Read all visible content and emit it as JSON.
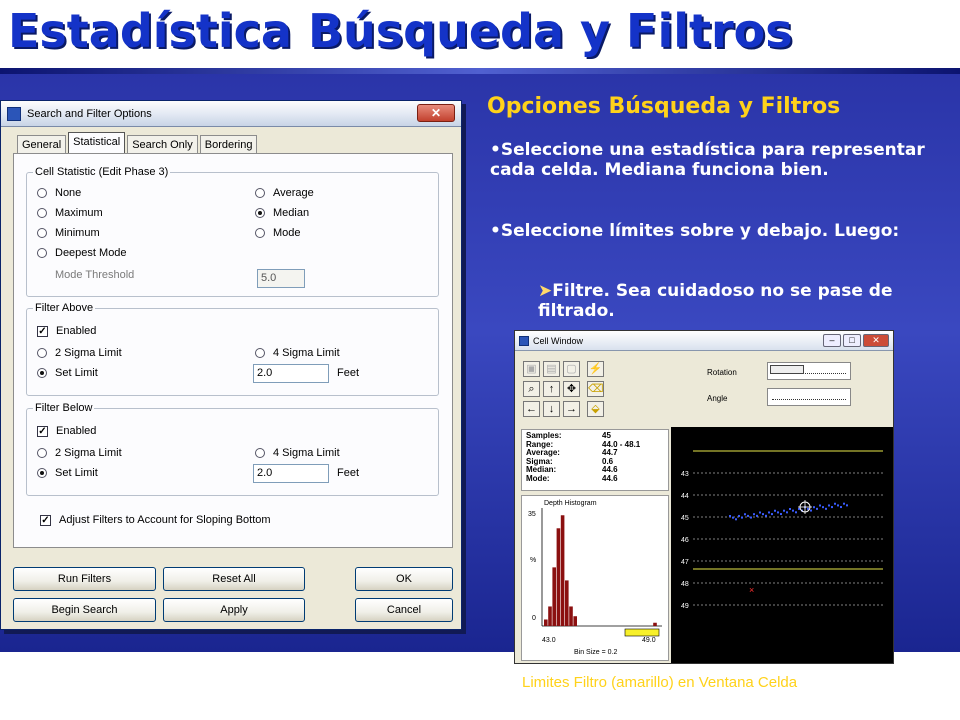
{
  "slide": {
    "title": "Estadística Búsqueda y Filtros",
    "heading": "Opciones Búsqueda y Filtros",
    "bullet1": "•Seleccione una estadística para representar cada celda.  Mediana funciona bien.",
    "bullet2": "•Seleccione límites sobre y debajo. Luego:",
    "bullet3": "Filtre.  Sea cuidadoso no se pase de filtrado.",
    "bullet3_marker": "➤",
    "caption": "Limites Filtro (amarillo) en Ventana Celda",
    "colors": {
      "title": "#1433c8",
      "heading": "#ffd21a",
      "background": "#2a34a8"
    }
  },
  "dialog": {
    "title": "Search and Filter Options",
    "close_label": "✕",
    "tabs": [
      "General",
      "Statistical",
      "Search Only",
      "Bordering"
    ],
    "active_tab": "Statistical",
    "cell_statistic": {
      "label": "Cell Statistic (Edit Phase 3)",
      "none": "None",
      "maximum": "Maximum",
      "minimum": "Minimum",
      "deepest_mode": "Deepest Mode",
      "average": "Average",
      "median": "Median",
      "mode": "Mode",
      "selected": "Median",
      "mode_threshold_label": "Mode Threshold",
      "mode_threshold_value": "5.0"
    },
    "filter_above": {
      "label": "Filter Above",
      "enabled": "Enabled",
      "enabled_checked": true,
      "sigma2": "2 Sigma Limit",
      "sigma4": "4 Sigma Limit",
      "set_limit": "Set Limit",
      "selected": "Set Limit",
      "value": "2.0",
      "unit": "Feet"
    },
    "filter_below": {
      "label": "Filter Below",
      "enabled": "Enabled",
      "enabled_checked": true,
      "sigma2": "2 Sigma Limit",
      "sigma4": "4 Sigma Limit",
      "set_limit": "Set Limit",
      "selected": "Set Limit",
      "value": "2.0",
      "unit": "Feet"
    },
    "adjust_label": "Adjust Filters to Account for Sloping Bottom",
    "adjust_checked": true,
    "buttons": {
      "run_filters": "Run Filters",
      "reset_all": "Reset All",
      "ok": "OK",
      "begin_search": "Begin Search",
      "apply": "Apply",
      "cancel": "Cancel"
    }
  },
  "cell_window": {
    "title": "Cell Window",
    "rotation_label": "Rotation",
    "angle_label": "Angle",
    "stats": [
      {
        "label": "Samples:",
        "value": "45"
      },
      {
        "label": "Range:",
        "value": "44.0 - 48.1"
      },
      {
        "label": "Average:",
        "value": "44.7"
      },
      {
        "label": "Sigma:",
        "value": "0.6"
      },
      {
        "label": "Median:",
        "value": "44.6"
      },
      {
        "label": "Mode:",
        "value": "44.6"
      }
    ],
    "histogram": {
      "title": "Depth Histogram",
      "y_top": "35",
      "y_mid": "%",
      "y_bottom": "0",
      "x_min": "43.0",
      "x_max": "49.0",
      "bin_size": "Bin Size = 0.2",
      "values": [
        2,
        6,
        18,
        30,
        34,
        14,
        6,
        3,
        0,
        0,
        0,
        0,
        0,
        0,
        0,
        0,
        0,
        0,
        0,
        0,
        0,
        0,
        0,
        0,
        0,
        0,
        1
      ]
    },
    "depth_ticks": [
      "43",
      "44",
      "45",
      "46",
      "47",
      "48",
      "49"
    ],
    "colors": {
      "filter_line": "#e8e84a",
      "soundings": "#3a5cff",
      "histogram_bar": "#8b1010"
    }
  }
}
